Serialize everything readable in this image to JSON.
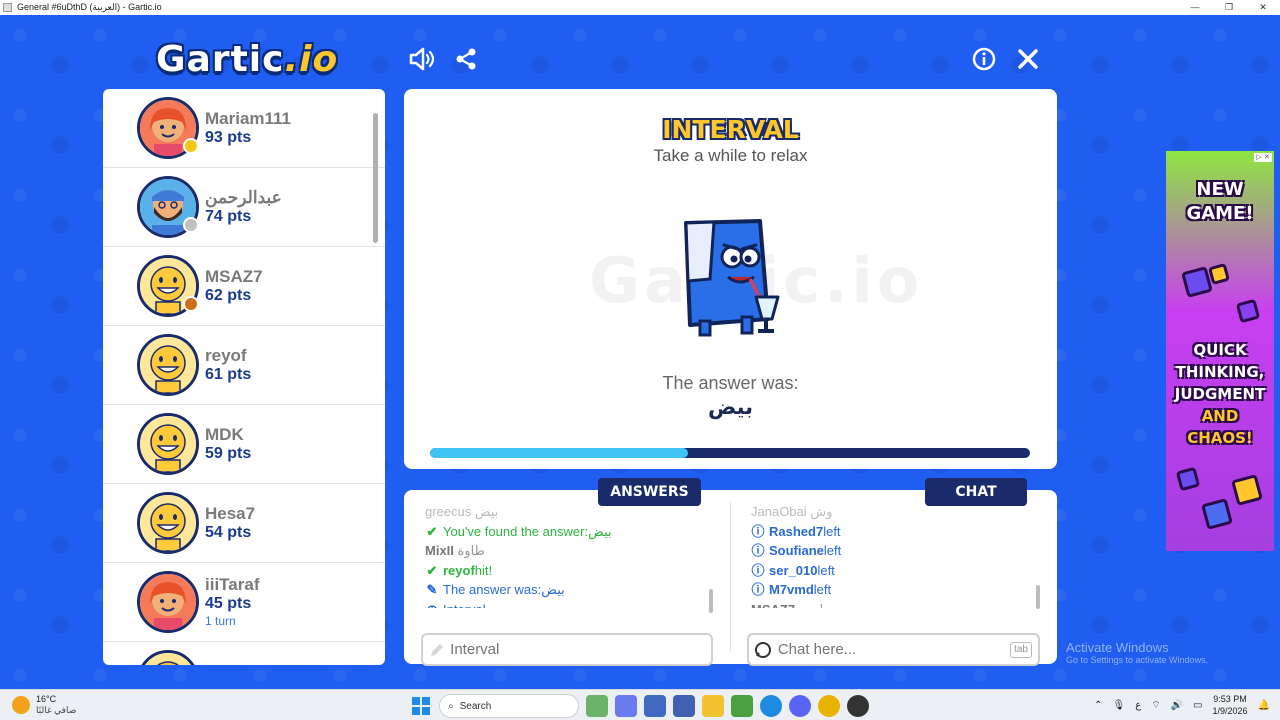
{
  "window": {
    "title": "General #6uDthD (العربية) - Gartic.io",
    "controls": [
      "—",
      "❐",
      "✕"
    ]
  },
  "header": {
    "logo_main": "Gartic",
    "logo_suffix": ".io"
  },
  "players": [
    {
      "name": "Mariam111",
      "points": "93 pts",
      "turn": "",
      "avatar": "girl",
      "badge_color": "#f5c518"
    },
    {
      "name": "عبدالرحمن",
      "points": "74 pts",
      "turn": "",
      "avatar": "bearded",
      "badge_color": "#c0c0c0"
    },
    {
      "name": "MSAZ7",
      "points": "62 pts",
      "turn": "",
      "avatar": "smiley",
      "badge_color": "#cd6e1a"
    },
    {
      "name": "reyof",
      "points": "61 pts",
      "turn": "",
      "avatar": "smiley",
      "badge_color": ""
    },
    {
      "name": "MDK",
      "points": "59 pts",
      "turn": "",
      "avatar": "smiley",
      "badge_color": ""
    },
    {
      "name": "Hesa7",
      "points": "54 pts",
      "turn": "",
      "avatar": "smiley",
      "badge_color": ""
    },
    {
      "name": "iiiTaraf",
      "points": "45 pts",
      "turn": "1 turn",
      "avatar": "girl",
      "badge_color": ""
    }
  ],
  "stage": {
    "title": "INTERVAL",
    "subtitle": "Take a while to relax",
    "watermark": "Gartic.io",
    "answer_label": "The answer was:",
    "answer_word": "بيض",
    "progress": 0.43
  },
  "answers": {
    "tab_label": "ANSWERS",
    "rows": [
      {
        "icon": "",
        "name": "greecus",
        "text": "بيض",
        "style": "faded"
      },
      {
        "icon": "check",
        "name": "",
        "text": "You've found the answer: ",
        "extra": "بيض",
        "style": "green"
      },
      {
        "icon": "",
        "name": "MixII",
        "text": "طاوة",
        "style": "grey"
      },
      {
        "icon": "check",
        "name": "reyof",
        "text": " hit!",
        "style": "green-name"
      },
      {
        "icon": "pencil",
        "name": "",
        "text": "The answer was: ",
        "extra": "بيض",
        "style": "blue"
      },
      {
        "icon": "clock",
        "name": "",
        "text": "Interval...",
        "style": "blue"
      }
    ],
    "input_placeholder": "Interval"
  },
  "chat": {
    "tab_label": "CHAT",
    "rows": [
      {
        "icon": "",
        "name": "JanaObai",
        "text": "وش",
        "style": "faded"
      },
      {
        "icon": "info",
        "name": "Rashed7",
        "text": " left",
        "style": "info"
      },
      {
        "icon": "info",
        "name": "Soufiane",
        "text": " left",
        "style": "info"
      },
      {
        "icon": "info",
        "name": "ser_010",
        "text": " left",
        "style": "info"
      },
      {
        "icon": "info",
        "name": "M7vmd",
        "text": " left",
        "style": "info"
      },
      {
        "icon": "",
        "name": "MSAZ7",
        "text": "ايزي",
        "style": "msg"
      }
    ],
    "input_placeholder": "Chat here...",
    "tab_key": "tab"
  },
  "ad": {
    "line1": "NEW",
    "line2": "GAME!",
    "line3": "QUICK",
    "line4": "THINKING,",
    "line5": "JUDGMENT",
    "line6": "AND",
    "line7": "CHAOS!",
    "badge": "▷ ✕"
  },
  "activate_windows": {
    "line1": "Activate Windows",
    "line2": "Go to Settings to activate Windows."
  },
  "taskbar": {
    "weather_temp": "16°C",
    "weather_desc": "صافي غالبًا",
    "search_label": "Search",
    "lang": "ع",
    "time": "9:53 PM",
    "date": "1/9/2026"
  },
  "colors": {
    "background": "#1f5ef0",
    "navy": "#1a2b6b",
    "yellow": "#ffc72c",
    "green": "#2db33e",
    "blue": "#2a6ad6"
  }
}
